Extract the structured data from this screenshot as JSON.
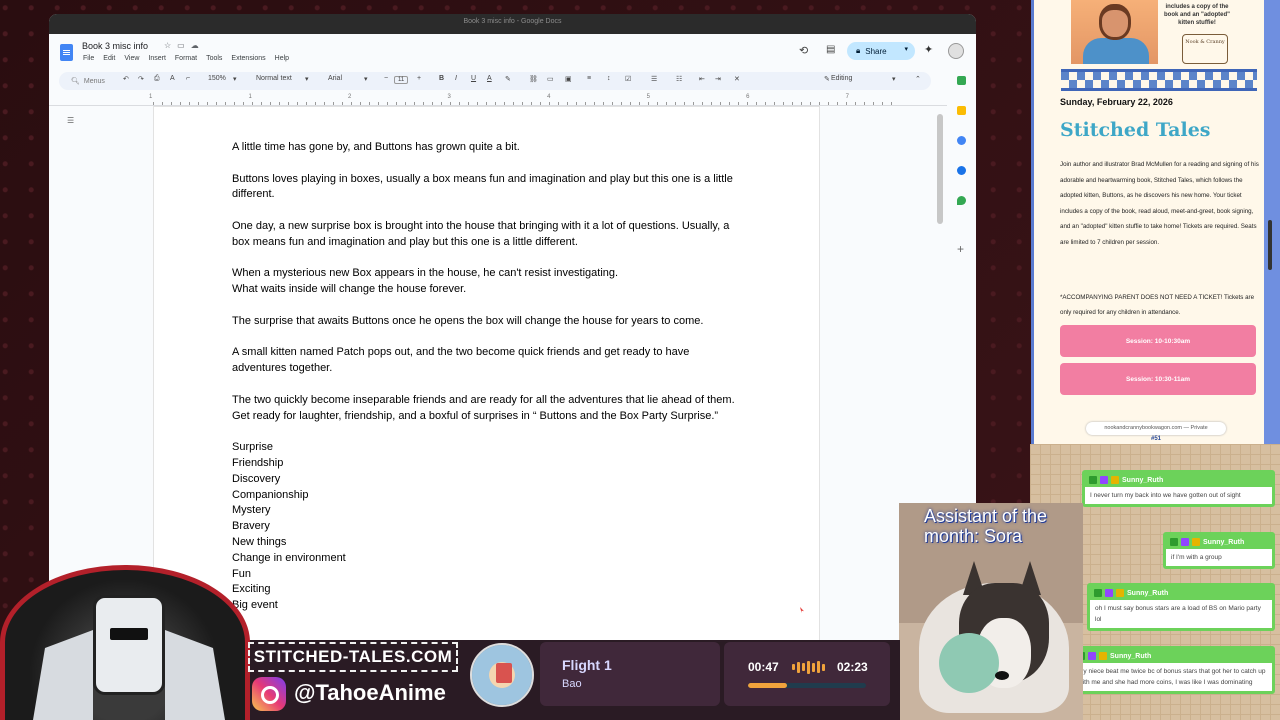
{
  "window": {
    "title": "Book 3 misc info - Google Docs"
  },
  "doc": {
    "title": "Book 3 misc info",
    "menus": [
      "File",
      "Edit",
      "View",
      "Insert",
      "Format",
      "Tools",
      "Extensions",
      "Help"
    ],
    "share_label": "Share",
    "toolbar": {
      "menus_label": "Menus",
      "zoom": "150%",
      "style": "Normal text",
      "font": "Arial",
      "font_size": "11",
      "mode": "Editing"
    },
    "ruler_numbers": [
      "1",
      "1",
      "2",
      "3",
      "4",
      "5",
      "6",
      "7"
    ],
    "paragraphs": [
      "A little time has gone by, and Buttons has grown quite a bit.",
      "Buttons loves playing in boxes, usually a box means fun and imagination and play but this one is a little different.",
      "One day, a new surprise box is brought into the house that bringing with it a lot of questions. Usually, a box means fun and imagination and play but this one is a little different.",
      "When a mysterious new Box appears in the house, he can't resist investigating.\nWhat waits inside will change the house forever.",
      "The surprise that awaits Buttons once he opens the box will change the house for years to come.",
      "A small kitten named Patch pops out, and the two become quick friends and get ready to have adventures together.",
      "The two quickly become inseparable friends and are ready for all the adventures that lie ahead of them. Get ready for laughter, friendship, and a boxful of surprises in “ Buttons and the Box Party Surprise.”"
    ],
    "keywords": [
      "Surprise",
      "Friendship",
      "Discovery",
      "Companionship",
      "Mystery",
      "Bravery",
      "New things",
      "Change in environment",
      "Fun",
      "Exciting",
      "Big event"
    ]
  },
  "flyer": {
    "top_text": "includes a copy of the book and an \"adopted\" kitten stuffie!",
    "logo_text": "Nook & Cranny",
    "date": "Sunday, February 22, 2026",
    "title": "Stitched Tales",
    "description": "Join author and illustrator Brad McMullen for a reading and signing of his adorable and heartwarming book, Stitched Tales, which follows the adopted kitten, Buttons, as he discovers his new home. Your ticket includes a copy of the book, read aloud, meet-and-greet, book signing, and an \"adopted\" kitten stuffie to take home! Tickets are required. Seats are limited to 7 children per session.",
    "note": "*ACCOMPANYING PARENT DOES NOT NEED A TICKET! Tickets are only required for any children in attendance.",
    "sessions": [
      "Session: 10-10:30am",
      "Session: 10:30-11am"
    ],
    "url": "nookandcrannybookwagon.com — Private",
    "badge": "#51"
  },
  "chat": [
    {
      "user": "Sunny_Ruth",
      "text": "I never turn my back into we have gotten out of sight"
    },
    {
      "user": "Sunny_Ruth",
      "text": "if I'm with a group"
    },
    {
      "user": "Sunny_Ruth",
      "text": "oh I must say bonus stars are a load of BS on Mario party lol"
    },
    {
      "user": "Sunny_Ruth",
      "text": "my niece beat me twice bc of bonus stars that got her to catch up with me and she had more coins, I was like I was dominating"
    }
  ],
  "overlay": {
    "assistant_caption": "Assistant of the month: Sora",
    "site": "STITCHED-TALES.COM",
    "instagram": "@TahoeAnime",
    "song_title": "Flight 1",
    "song_artist": "Bao",
    "elapsed": "00:47",
    "total": "02:23",
    "progress": 0.33
  },
  "colors": {
    "accent": "#3ea7c7",
    "session_button": "#f27ea2",
    "chat_green": "#6cd25a",
    "progress": "#f0a33c"
  }
}
